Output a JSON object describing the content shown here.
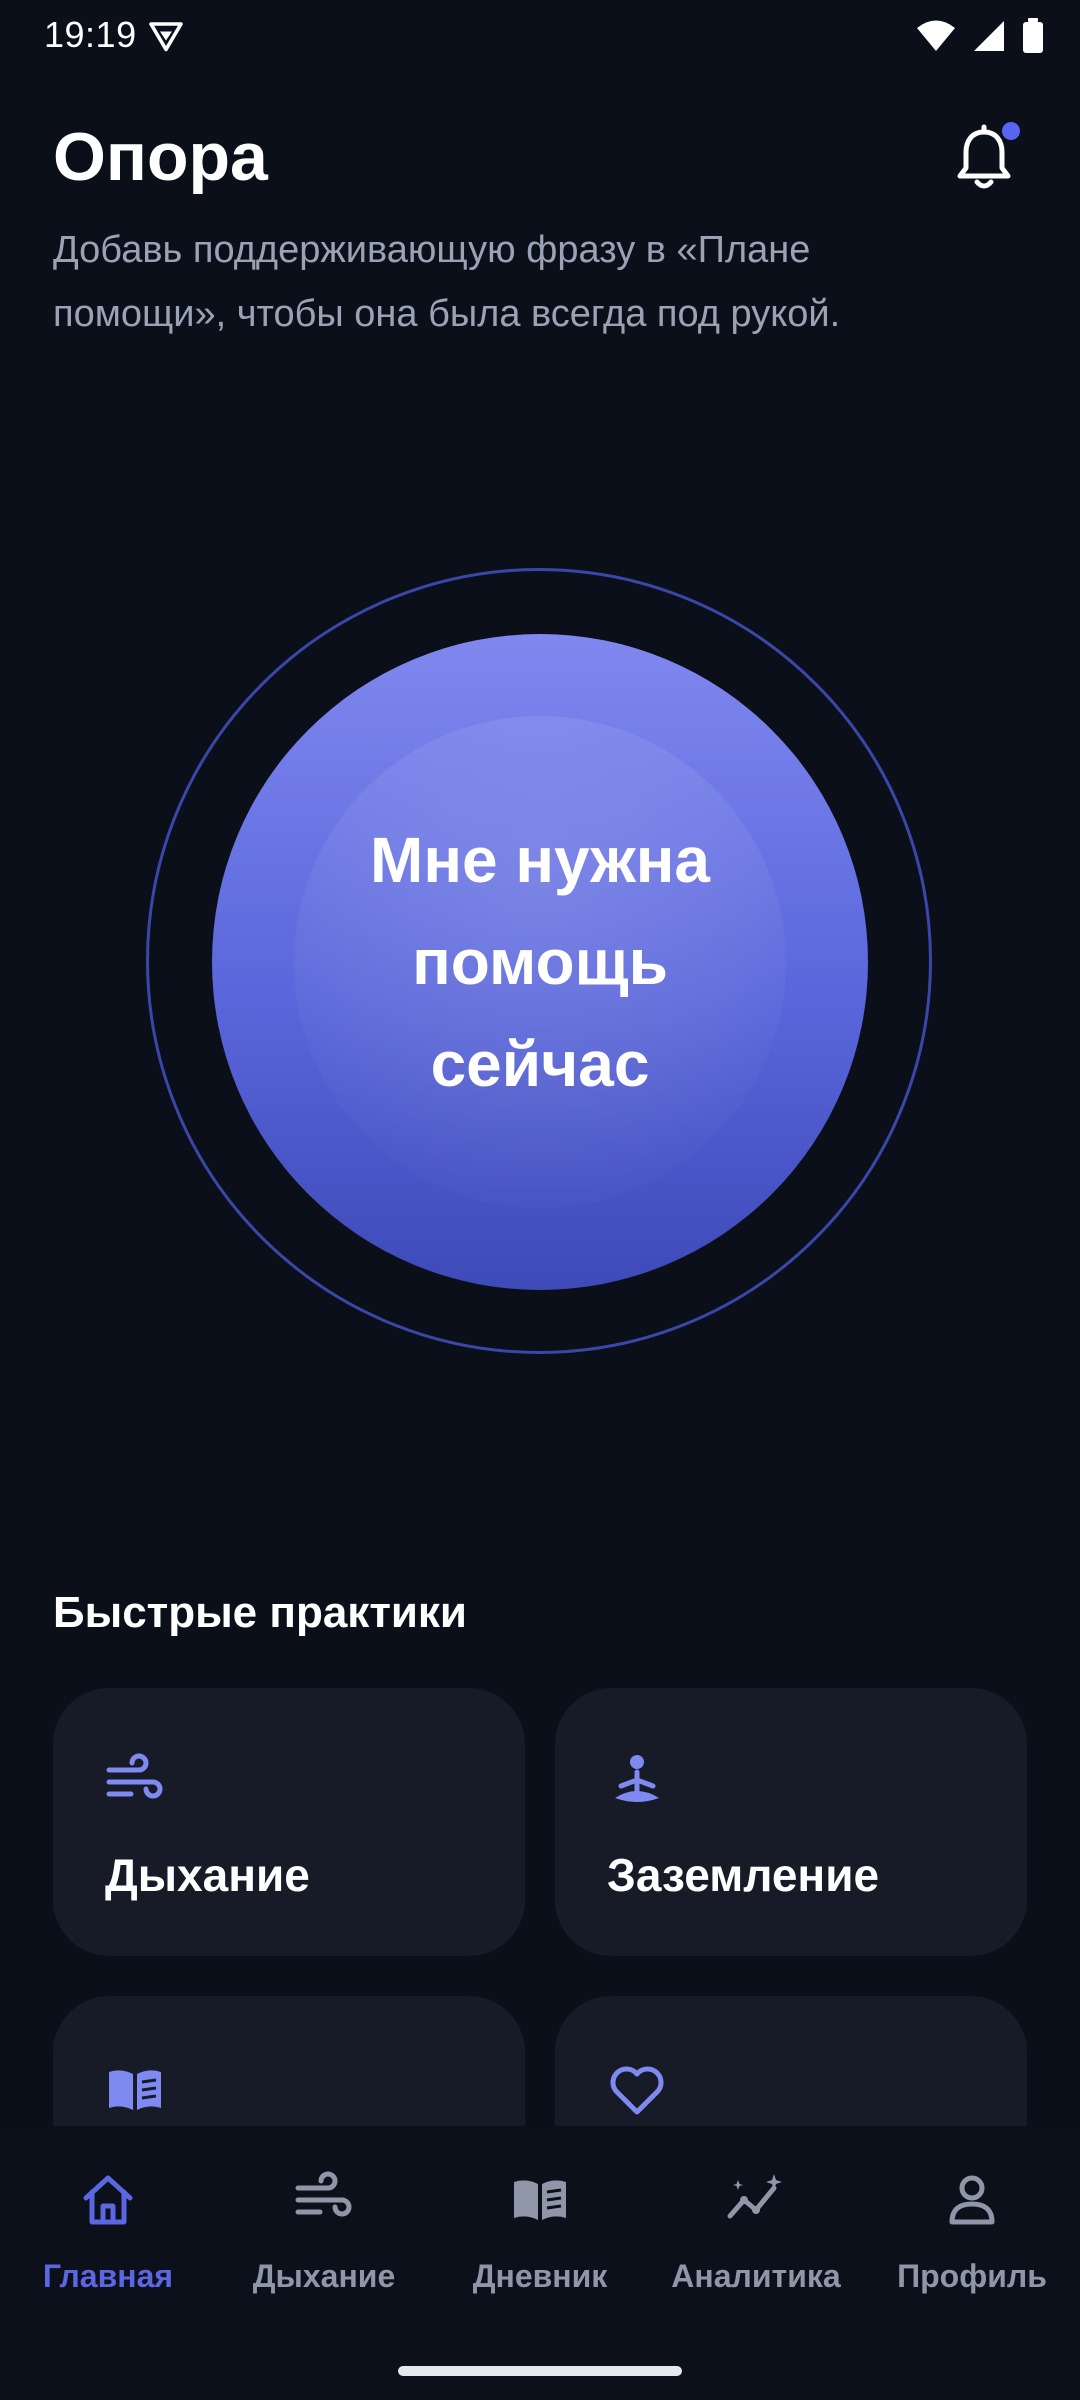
{
  "status_bar": {
    "time": "19:19"
  },
  "header": {
    "title": "Опора",
    "subtitle": "Добавь поддерживающую фразу в «Плане помощи», чтобы она была всегда под рукой.",
    "has_notification": true
  },
  "help_button": {
    "label": "Мне нужна\nпомощь\nсейчас"
  },
  "quick_practices": {
    "title": "Быстрые практики",
    "items": [
      {
        "label": "Дыхание",
        "icon": "wind-icon"
      },
      {
        "label": "Заземление",
        "icon": "meditation-icon"
      },
      {
        "label": "",
        "icon": "journal-book-icon"
      },
      {
        "label": "",
        "icon": "heart-icon"
      }
    ]
  },
  "bottom_nav": {
    "items": [
      {
        "label": "Главная",
        "icon": "home-icon",
        "active": true
      },
      {
        "label": "Дыхание",
        "icon": "wind-icon",
        "active": false
      },
      {
        "label": "Дневник",
        "icon": "book-icon",
        "active": false
      },
      {
        "label": "Аналитика",
        "icon": "analytics-sparkle-icon",
        "active": false
      },
      {
        "label": "Профиль",
        "icon": "profile-icon",
        "active": false
      }
    ]
  },
  "colors": {
    "background": "#0a0f1a",
    "accent": "#5b66e0",
    "card": "#161b27",
    "icon_accent": "#7f8af0",
    "muted_text": "#9aa3b5"
  }
}
